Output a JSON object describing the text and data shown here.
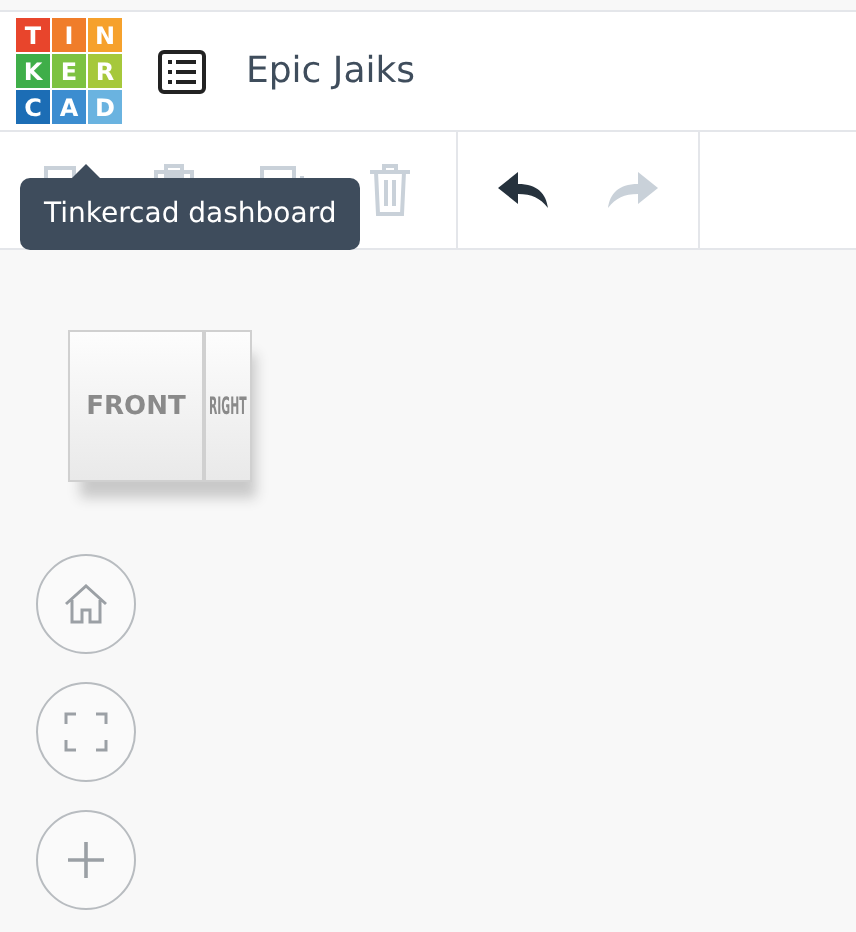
{
  "logo": {
    "tiles": [
      {
        "letter": "T",
        "color": "#e8452c"
      },
      {
        "letter": "I",
        "color": "#f07d2a"
      },
      {
        "letter": "N",
        "color": "#f6a12c"
      },
      {
        "letter": "K",
        "color": "#3fae49"
      },
      {
        "letter": "E",
        "color": "#7dc242"
      },
      {
        "letter": "R",
        "color": "#a6c83b"
      },
      {
        "letter": "C",
        "color": "#1c6db5"
      },
      {
        "letter": "A",
        "color": "#3c8dd0"
      },
      {
        "letter": "D",
        "color": "#6ab3e0"
      }
    ]
  },
  "header": {
    "title": "Epic Jaiks"
  },
  "toolbar": {
    "groups": [
      [
        {
          "kind": "copy",
          "disabled": true
        },
        {
          "kind": "paste",
          "disabled": true
        },
        {
          "kind": "duplicate",
          "disabled": true
        },
        {
          "kind": "delete",
          "disabled": true
        }
      ],
      [
        {
          "kind": "undo",
          "disabled": false
        },
        {
          "kind": "redo",
          "disabled": true
        }
      ]
    ]
  },
  "tooltip": {
    "text": "Tinkercad dashboard"
  },
  "view_cube": {
    "front": "FRONT",
    "right": "RIGHT"
  },
  "view_controls": [
    {
      "kind": "home"
    },
    {
      "kind": "fit"
    },
    {
      "kind": "zoom-in"
    }
  ]
}
